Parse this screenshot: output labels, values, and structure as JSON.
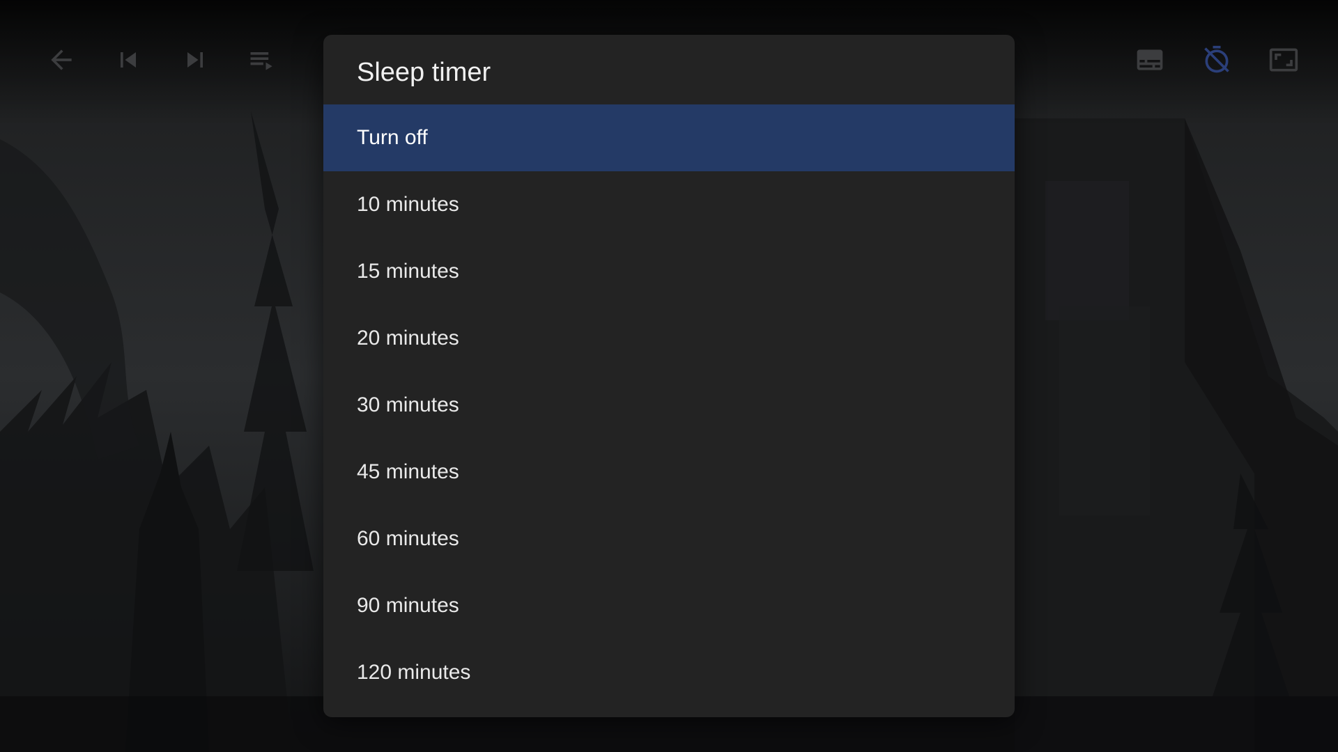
{
  "player_controls": {
    "left": [
      {
        "icon": "back-arrow-icon"
      },
      {
        "icon": "skip-previous-icon"
      },
      {
        "icon": "skip-next-icon"
      },
      {
        "icon": "playlist-icon"
      }
    ],
    "right": [
      {
        "icon": "subtitles-icon"
      },
      {
        "icon": "timer-off-icon",
        "color": "#2b3f7a"
      },
      {
        "icon": "aspect-ratio-icon"
      }
    ]
  },
  "dialog": {
    "title": "Sleep timer",
    "selected_index": 0,
    "selected_color": "#243a66",
    "options": [
      {
        "label": "Turn off"
      },
      {
        "label": "10 minutes"
      },
      {
        "label": "15 minutes"
      },
      {
        "label": "20 minutes"
      },
      {
        "label": "30 minutes"
      },
      {
        "label": "45 minutes"
      },
      {
        "label": "60 minutes"
      },
      {
        "label": "90 minutes"
      },
      {
        "label": "120 minutes"
      }
    ]
  }
}
